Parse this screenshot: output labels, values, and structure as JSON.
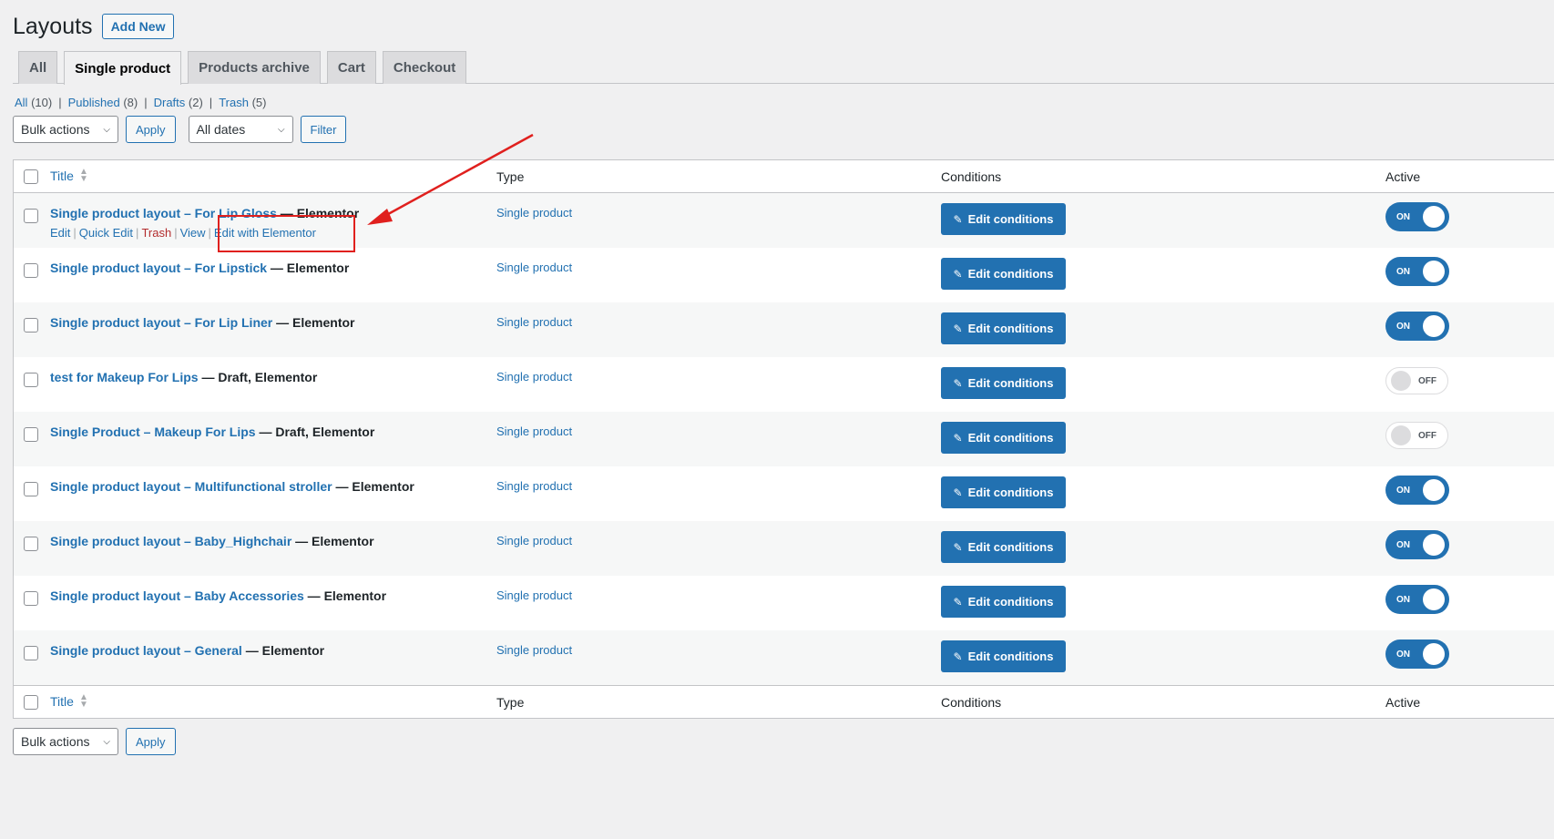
{
  "header": {
    "title": "Layouts",
    "add_new": "Add New"
  },
  "tabs": [
    {
      "label": "All",
      "active": false
    },
    {
      "label": "Single product",
      "active": true
    },
    {
      "label": "Products archive",
      "active": false
    },
    {
      "label": "Cart",
      "active": false
    },
    {
      "label": "Checkout",
      "active": false
    }
  ],
  "views": {
    "all_label": "All",
    "all_count": "(10)",
    "published_label": "Published",
    "published_count": "(8)",
    "drafts_label": "Drafts",
    "drafts_count": "(2)",
    "trash_label": "Trash",
    "trash_count": "(5)",
    "separator": "|"
  },
  "tablenav_top": {
    "bulk_actions": "Bulk actions",
    "apply": "Apply",
    "dates": "All dates",
    "filter": "Filter"
  },
  "tablenav_bottom": {
    "bulk_actions": "Bulk actions",
    "apply": "Apply"
  },
  "columns": {
    "title": "Title",
    "type": "Type",
    "conditions": "Conditions",
    "active": "Active"
  },
  "row_actions": {
    "edit": "Edit",
    "quick_edit": "Quick Edit",
    "trash": "Trash",
    "view": "View",
    "edit_with_elementor": "Edit with Elementor",
    "separator": "|"
  },
  "edit_conditions_label": "Edit conditions",
  "toggle_on_label": "ON",
  "toggle_off_label": "OFF",
  "rows": [
    {
      "title": "Single product layout – For Lip Gloss",
      "state": " — Elementor",
      "type": "Single product",
      "active": true
    },
    {
      "title": "Single product layout – For Lipstick",
      "state": " — Elementor",
      "type": "Single product",
      "active": true
    },
    {
      "title": "Single product layout – For Lip Liner",
      "state": " — Elementor",
      "type": "Single product",
      "active": true
    },
    {
      "title": "test for Makeup For Lips",
      "state": " — Draft, Elementor",
      "type": "Single product",
      "active": false
    },
    {
      "title": "Single Product – Makeup For Lips",
      "state": " — Draft, Elementor",
      "type": "Single product",
      "active": false
    },
    {
      "title": "Single product layout – Multifunctional stroller",
      "state": " — Elementor",
      "type": "Single product",
      "active": true
    },
    {
      "title": "Single product layout – Baby_Highchair",
      "state": " — Elementor",
      "type": "Single product",
      "active": true
    },
    {
      "title": "Single product layout – Baby Accessories",
      "state": " — Elementor",
      "type": "Single product",
      "active": true
    },
    {
      "title": "Single product layout – General",
      "state": " — Elementor",
      "type": "Single product",
      "active": true
    }
  ],
  "colors": {
    "accent": "#2271b1",
    "annotation": "#e0201e",
    "trash": "#b32d2e"
  }
}
